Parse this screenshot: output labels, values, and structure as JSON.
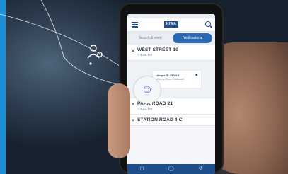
{
  "app": {
    "logo_text": "KIWA",
    "brand_color": "#1f4e8c",
    "accent_color": "#2c69b3"
  },
  "tabs": [
    {
      "label": "Search & send",
      "active": false
    },
    {
      "label": "Notifications",
      "active": true
    }
  ],
  "locations": [
    {
      "name": "WEST STREET 10",
      "distance": "1.98 km",
      "expanded": true
    },
    {
      "name": "PARK ROAD 21",
      "distance": "1.81 km",
      "expanded": false
    },
    {
      "name": "STATION ROAD 4 C",
      "distance": "",
      "expanded": false
    }
  ],
  "device": {
    "name": "Unique ID 2308141",
    "status": "Leaving Room 1 alkoovitt"
  },
  "icons": {
    "menu": "menu-icon",
    "search": "search-icon",
    "pin": "pin-icon",
    "user": "user-icon",
    "flag": "flag-icon",
    "nav": [
      "square-icon",
      "home-icon",
      "back-icon"
    ]
  }
}
